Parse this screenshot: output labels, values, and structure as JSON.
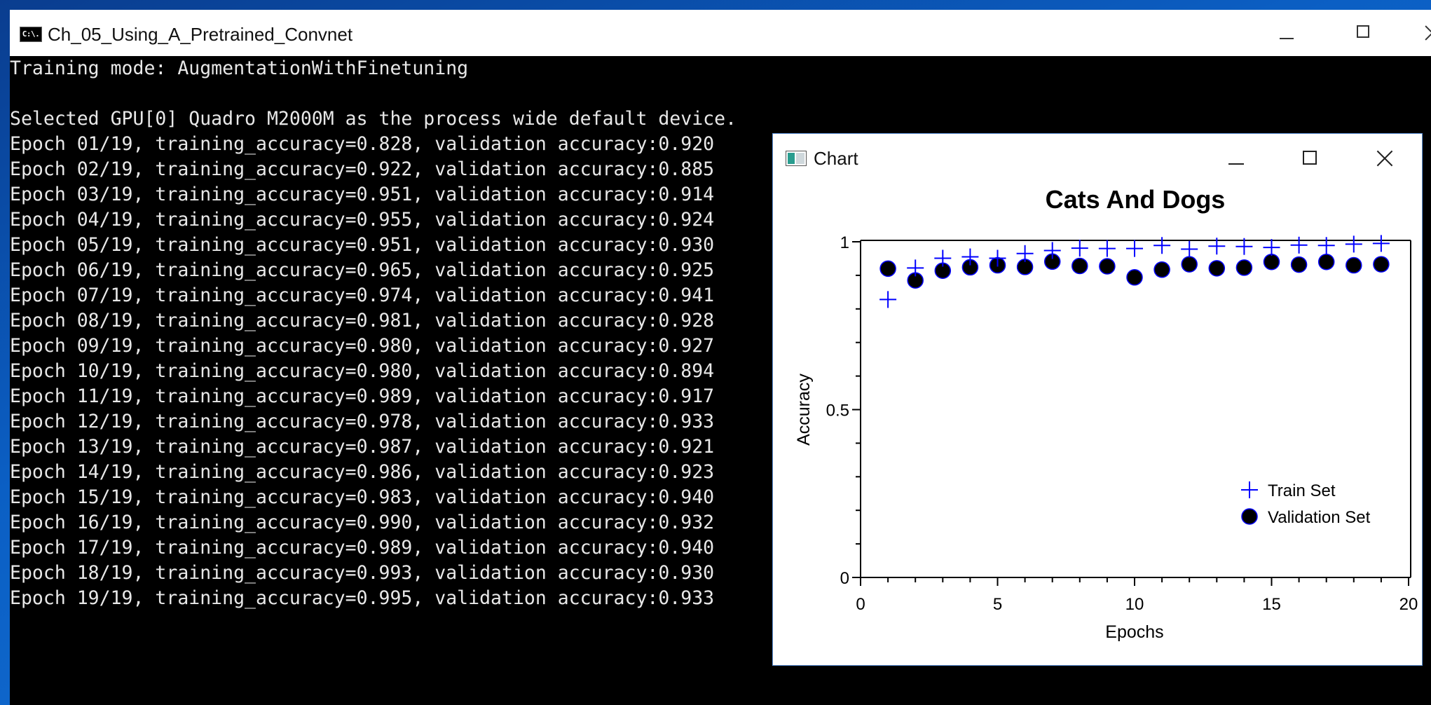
{
  "console": {
    "title": "Ch_05_Using_A_Pretrained_Convnet",
    "icon_text": "C:\\.",
    "lines": [
      "Training mode: AugmentationWithFinetuning",
      "",
      "Selected GPU[0] Quadro M2000M as the process wide default device.",
      "Epoch 01/19, training_accuracy=0.828, validation accuracy:0.920",
      "Epoch 02/19, training_accuracy=0.922, validation accuracy:0.885",
      "Epoch 03/19, training_accuracy=0.951, validation accuracy:0.914",
      "Epoch 04/19, training_accuracy=0.955, validation accuracy:0.924",
      "Epoch 05/19, training_accuracy=0.951, validation accuracy:0.930",
      "Epoch 06/19, training_accuracy=0.965, validation accuracy:0.925",
      "Epoch 07/19, training_accuracy=0.974, validation accuracy:0.941",
      "Epoch 08/19, training_accuracy=0.981, validation accuracy:0.928",
      "Epoch 09/19, training_accuracy=0.980, validation accuracy:0.927",
      "Epoch 10/19, training_accuracy=0.980, validation accuracy:0.894",
      "Epoch 11/19, training_accuracy=0.989, validation accuracy:0.917",
      "Epoch 12/19, training_accuracy=0.978, validation accuracy:0.933",
      "Epoch 13/19, training_accuracy=0.987, validation accuracy:0.921",
      "Epoch 14/19, training_accuracy=0.986, validation accuracy:0.923",
      "Epoch 15/19, training_accuracy=0.983, validation accuracy:0.940",
      "Epoch 16/19, training_accuracy=0.990, validation accuracy:0.932",
      "Epoch 17/19, training_accuracy=0.989, validation accuracy:0.940",
      "Epoch 18/19, training_accuracy=0.993, validation accuracy:0.930",
      "Epoch 19/19, training_accuracy=0.995, validation accuracy:0.933"
    ]
  },
  "chart_window": {
    "title": "Chart"
  },
  "chart_data": {
    "type": "scatter",
    "title": "Cats And Dogs",
    "xlabel": "Epochs",
    "ylabel": "Accuracy",
    "xlim": [
      0,
      20
    ],
    "ylim": [
      0,
      1
    ],
    "x_ticks": [
      0,
      5,
      10,
      15,
      20
    ],
    "y_ticks": [
      0,
      0.5,
      1
    ],
    "legend_position": "bottom-right",
    "x": [
      1,
      2,
      3,
      4,
      5,
      6,
      7,
      8,
      9,
      10,
      11,
      12,
      13,
      14,
      15,
      16,
      17,
      18,
      19
    ],
    "series": [
      {
        "name": "Train Set",
        "marker": "plus",
        "color": "#0000ff",
        "values": [
          0.828,
          0.922,
          0.951,
          0.955,
          0.951,
          0.965,
          0.974,
          0.981,
          0.98,
          0.98,
          0.989,
          0.978,
          0.987,
          0.986,
          0.983,
          0.99,
          0.989,
          0.993,
          0.995
        ]
      },
      {
        "name": "Validation Set",
        "marker": "circle",
        "color": "#000000",
        "stroke": "#0000ff",
        "values": [
          0.92,
          0.885,
          0.914,
          0.924,
          0.93,
          0.925,
          0.941,
          0.928,
          0.927,
          0.894,
          0.917,
          0.933,
          0.921,
          0.923,
          0.94,
          0.932,
          0.94,
          0.93,
          0.933
        ]
      }
    ]
  }
}
